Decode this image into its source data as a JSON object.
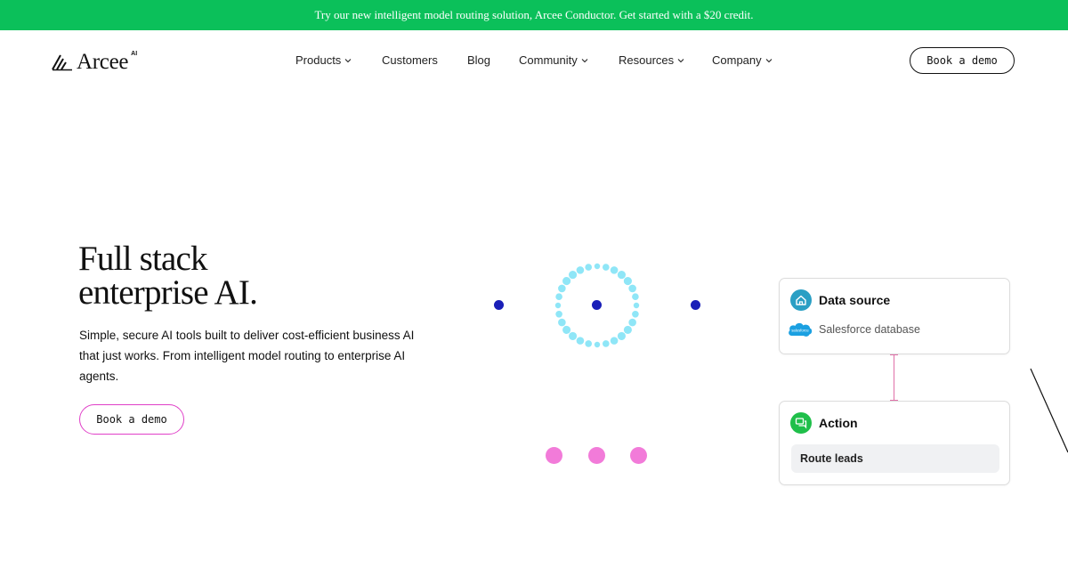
{
  "banner": {
    "text": "Try our new intelligent model routing solution, Arcee Conductor. Get started with a $20 credit."
  },
  "logo": {
    "name": "Arcee",
    "superscript": "AI"
  },
  "nav": {
    "items": [
      {
        "label": "Products",
        "has_dropdown": true
      },
      {
        "label": "Customers",
        "has_dropdown": false
      },
      {
        "label": "Blog",
        "has_dropdown": false
      },
      {
        "label": "Community",
        "has_dropdown": true
      },
      {
        "label": "Resources",
        "has_dropdown": true
      },
      {
        "label": "Company",
        "has_dropdown": true
      }
    ],
    "cta_label": "Book a demo"
  },
  "hero": {
    "title_line1": "Full stack",
    "title_line2": "enterprise AI.",
    "subtitle": "Simple, secure AI tools built to deliver cost-efficient business AI that just works. From intelligent model routing to enterprise AI agents.",
    "cta_label": "Book a demo"
  },
  "workflow": {
    "data_source": {
      "title": "Data source",
      "source_label": "Salesforce database",
      "logo_text": "salesforce"
    },
    "action": {
      "title": "Action",
      "step_label": "Route leads"
    }
  },
  "colors": {
    "banner": "#0bc05a",
    "accent_pink": "#e040c8",
    "dot_blue": "#1a1fb8",
    "dot_pink": "#f27bd9",
    "ring_cyan": "#8fe6f7",
    "salesforce_blue": "#1ba0e1",
    "icon_teal": "#2a9fc4",
    "icon_green": "#1fbf4a"
  },
  "icons": [
    "logo-mark-icon",
    "chevron-down-icon",
    "home-icon",
    "salesforce-icon",
    "chat-icon"
  ]
}
